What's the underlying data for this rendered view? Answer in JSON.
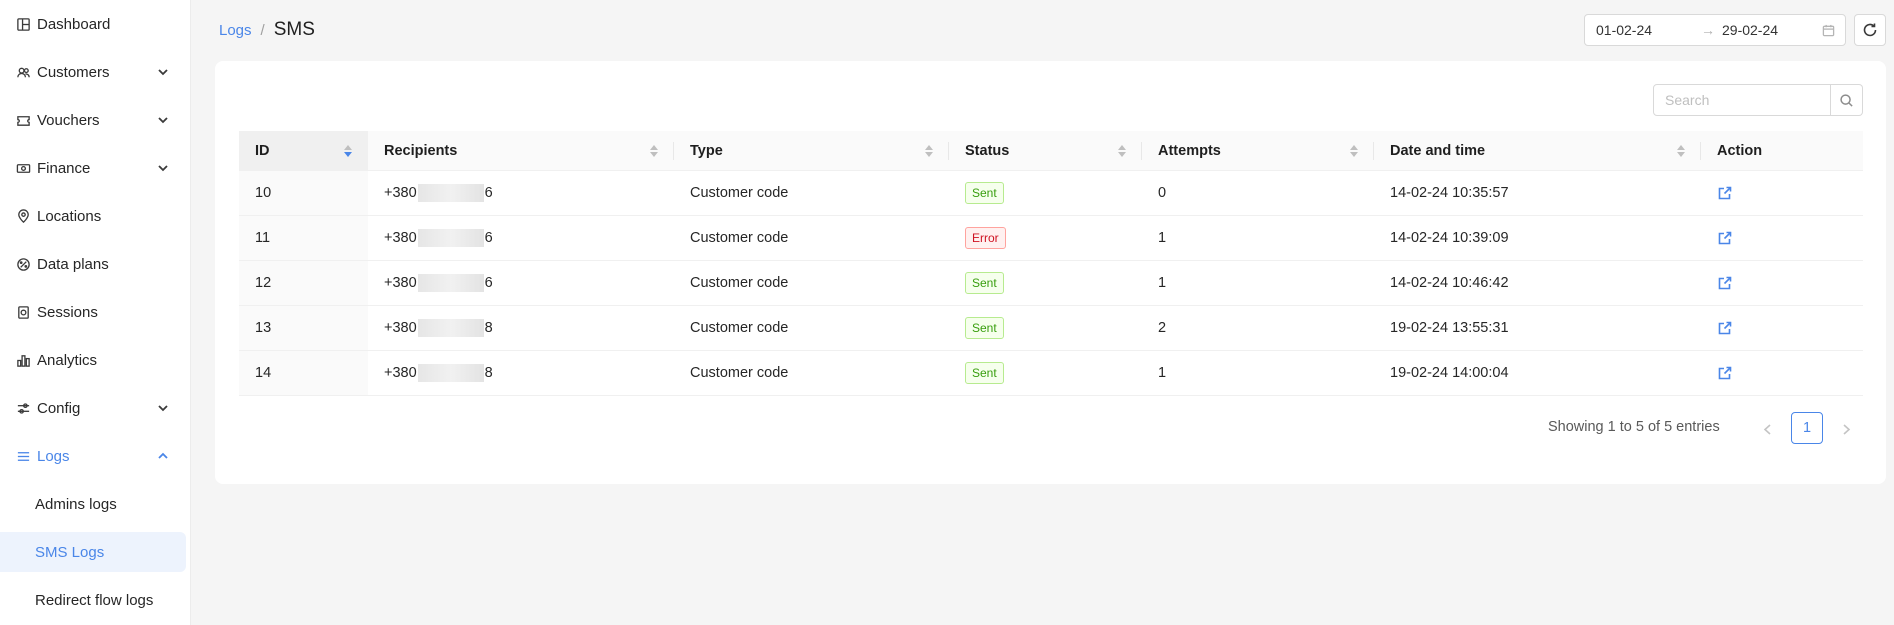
{
  "sidebar": {
    "items": [
      {
        "label": "Dashboard",
        "icon": "dashboard-icon"
      },
      {
        "label": "Customers",
        "icon": "customers-icon",
        "expandable": true
      },
      {
        "label": "Vouchers",
        "icon": "voucher-icon",
        "expandable": true
      },
      {
        "label": "Finance",
        "icon": "finance-icon",
        "expandable": true
      },
      {
        "label": "Locations",
        "icon": "location-pin-icon"
      },
      {
        "label": "Data plans",
        "icon": "data-plans-icon"
      },
      {
        "label": "Sessions",
        "icon": "sessions-icon"
      },
      {
        "label": "Analytics",
        "icon": "analytics-icon"
      },
      {
        "label": "Config",
        "icon": "sliders-icon",
        "expandable": true
      },
      {
        "label": "Logs",
        "icon": "logs-icon",
        "expandable": true,
        "expanded": true,
        "active": true
      }
    ],
    "logs_subitems": [
      {
        "label": "Admins logs"
      },
      {
        "label": "SMS Logs",
        "selected": true
      },
      {
        "label": "Redirect flow logs"
      }
    ]
  },
  "breadcrumb": {
    "parent": "Logs",
    "separator": "/",
    "current": "SMS"
  },
  "date_range": {
    "start": "01-02-24",
    "arrow": "→",
    "end": "29-02-24"
  },
  "search": {
    "placeholder": "Search",
    "value": ""
  },
  "table": {
    "columns": [
      "ID",
      "Recipients",
      "Type",
      "Status",
      "Attempts",
      "Date and time",
      "Action"
    ],
    "rows": [
      {
        "id": "10",
        "recipient_prefix": "+380",
        "recipient_suffix": "6",
        "type": "Customer code",
        "status": "Sent",
        "attempts": "0",
        "datetime": "14-02-24 10:35:57"
      },
      {
        "id": "11",
        "recipient_prefix": "+380",
        "recipient_suffix": "6",
        "type": "Customer code",
        "status": "Error",
        "attempts": "1",
        "datetime": "14-02-24 10:39:09"
      },
      {
        "id": "12",
        "recipient_prefix": "+380",
        "recipient_suffix": "6",
        "type": "Customer code",
        "status": "Sent",
        "attempts": "1",
        "datetime": "14-02-24 10:46:42"
      },
      {
        "id": "13",
        "recipient_prefix": "+380",
        "recipient_suffix": "8",
        "type": "Customer code",
        "status": "Sent",
        "attempts": "2",
        "datetime": "19-02-24 13:55:31"
      },
      {
        "id": "14",
        "recipient_prefix": "+380",
        "recipient_suffix": "8",
        "type": "Customer code",
        "status": "Sent",
        "attempts": "1",
        "datetime": "19-02-24 14:00:04"
      }
    ]
  },
  "pagination": {
    "summary": "Showing 1 to 5 of 5 entries",
    "current_page": "1"
  },
  "colors": {
    "accent": "#4a86e8",
    "sent": "#389e0d",
    "error": "#cf1322"
  }
}
